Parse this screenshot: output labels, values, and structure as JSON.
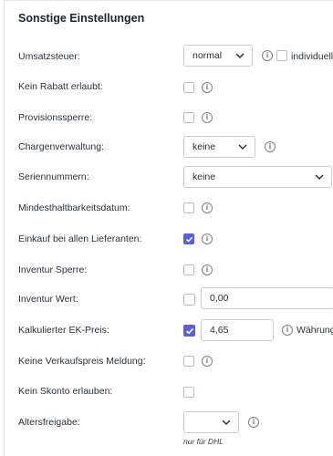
{
  "section": {
    "title": "Sonstige Einstellungen"
  },
  "rows": {
    "umsatzsteuer": {
      "label": "Umsatzsteuer:",
      "select_value": "normal",
      "extra_label": "individuelle"
    },
    "kein_rabatt": {
      "label": "Kein Rabatt erlaubt:",
      "checked": false
    },
    "provisionssperre": {
      "label": "Provisionssperre:",
      "checked": false
    },
    "chargenverwaltung": {
      "label": "Chargenverwaltung:",
      "select_value": "keine"
    },
    "seriennummern": {
      "label": "Seriennummern:",
      "select_value": "keine"
    },
    "mhd": {
      "label": "Mindesthaltbarkeitsdatum:",
      "checked": false
    },
    "einkauf": {
      "label": "Einkauf bei allen Lieferanten:",
      "checked": true
    },
    "inventur_sperre": {
      "label": "Inventur Sperre:",
      "checked": false
    },
    "inventur_wert": {
      "label": "Inventur Wert:",
      "checked": false,
      "value": "0,00"
    },
    "ek_preis": {
      "label": "Kalkulierter EK-Preis:",
      "checked": true,
      "value": "4,65",
      "extra_label": "Währung:"
    },
    "keine_vk_meldung": {
      "label": "Keine Verkaufspreis Meldung:",
      "checked": false
    },
    "kein_skonto": {
      "label": "Kein Skonto erlauben:",
      "checked": false
    },
    "altersfreigabe": {
      "label": "Altersfreigabe:",
      "select_value": "",
      "note": "nur für DHL"
    }
  },
  "icons": {
    "info": "info-icon",
    "chevron": "chevron-down-icon",
    "check": "checkmark-icon"
  },
  "colors": {
    "accent": "#5b5fd9",
    "border": "#c9ced6"
  }
}
